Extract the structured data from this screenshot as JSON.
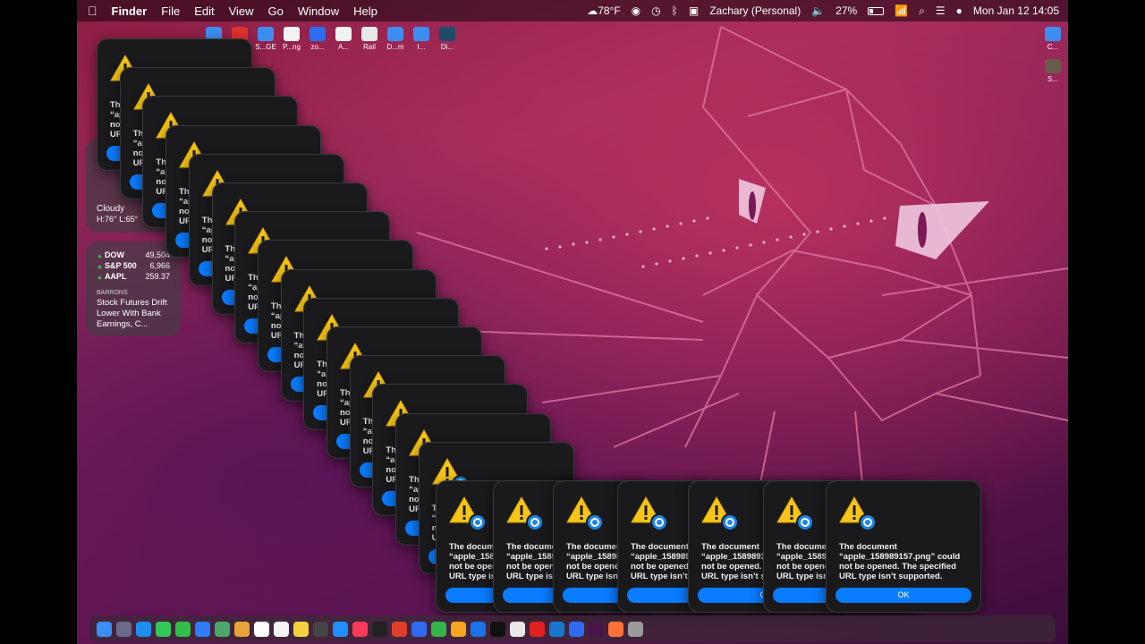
{
  "menubar": {
    "apple_icon": "apple-icon",
    "app_name": "Finder",
    "menus": [
      "File",
      "Edit",
      "View",
      "Go",
      "Window",
      "Help"
    ],
    "weather": "78°F",
    "user": "Zachary (Personal)",
    "battery": "27%",
    "datetime": "Mon Jan 12  14:05"
  },
  "desktop_icons": [
    {
      "label": "",
      "color": "#3d8ef0"
    },
    {
      "label": "",
      "color": "#e0302a"
    },
    {
      "label": "S...GE",
      "color": "#3d8ef0"
    },
    {
      "label": "P...ng",
      "color": "#f2f2f2"
    },
    {
      "label": "zo...",
      "color": "#2d6cf0"
    },
    {
      "label": "A...",
      "color": "#f2f2f2"
    },
    {
      "label": "Rail",
      "color": "#e8e8e8"
    },
    {
      "label": "D...m",
      "color": "#3d8ef0"
    },
    {
      "label": "I...",
      "color": "#3d8ef0"
    },
    {
      "label": "Di...",
      "color": "#1e4b6a"
    }
  ],
  "right_icons": [
    {
      "label": "C...",
      "color": "#3d8ef0"
    },
    {
      "label": "S...",
      "color": "#6a5a4a"
    }
  ],
  "weather_widget": {
    "condition": "Cloudy",
    "hilo": "H:76° L:65°"
  },
  "stocks_widget": {
    "rows": [
      {
        "symbol": "DOW",
        "value": "49,504"
      },
      {
        "symbol": "S&P 500",
        "value": "6,966"
      },
      {
        "symbol": "AAPL",
        "value": "259.37"
      }
    ],
    "source": "BARRONS",
    "headline": "Stock Futures Drift Lower With Bank Earnings, C..."
  },
  "alert": {
    "message": "The document “apple_158989157.png” could not be opened. The specified URL type isn’t supported.",
    "ok_label": "OK"
  },
  "dock": {
    "apps": [
      "finder",
      "launchpad",
      "safari",
      "messages",
      "facetime",
      "mail",
      "maps",
      "photos",
      "calendar",
      "reminders",
      "notes",
      "help",
      "appstore",
      "music",
      "tv",
      "news",
      "keynote",
      "numbers",
      "pages",
      "xcode",
      "notion",
      "chrome",
      "youtube",
      "quicktime",
      "zoom",
      "slack",
      "firefox",
      "trash"
    ]
  },
  "colors": {
    "accent": "#0a7cff",
    "warning": "#f5c518"
  }
}
